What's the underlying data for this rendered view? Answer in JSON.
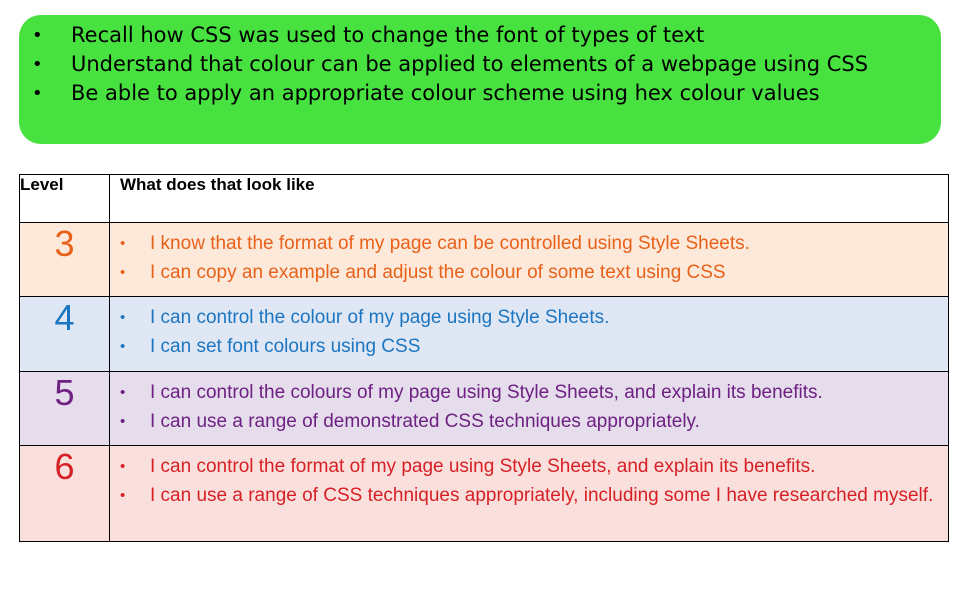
{
  "objectives": {
    "bullet": "•",
    "items": [
      "Recall how CSS was used to change the font of types of text",
      "Understand that colour can be applied to elements of a webpage using CSS",
      "Be able to apply an appropriate colour scheme using hex colour values"
    ]
  },
  "table": {
    "headers": {
      "level": "Level",
      "description": "What does that look like"
    },
    "rows": [
      {
        "level": "3",
        "items": [
          "I know that the format of my page can be controlled using Style Sheets.",
          "I can copy an example and adjust the colour of some text using CSS"
        ]
      },
      {
        "level": "4",
        "items": [
          "I can control the colour of my page using Style Sheets.",
          "I can set font colours using CSS"
        ]
      },
      {
        "level": "5",
        "items": [
          "I can control the colours of my page using Style Sheets, and explain its benefits.",
          "I can use a range of demonstrated CSS techniques appropriately."
        ]
      },
      {
        "level": "6",
        "items": [
          "I can control the format of my page using Style Sheets, and explain its benefits.",
          "I can use a range of CSS techniques appropriately, including some I have researched myself."
        ]
      }
    ]
  },
  "colors": {
    "objectives_bg": "#47e23f",
    "level3": "#e8611a",
    "level4": "#1c75c0",
    "level5": "#6e2083",
    "level6": "#d71f26"
  }
}
